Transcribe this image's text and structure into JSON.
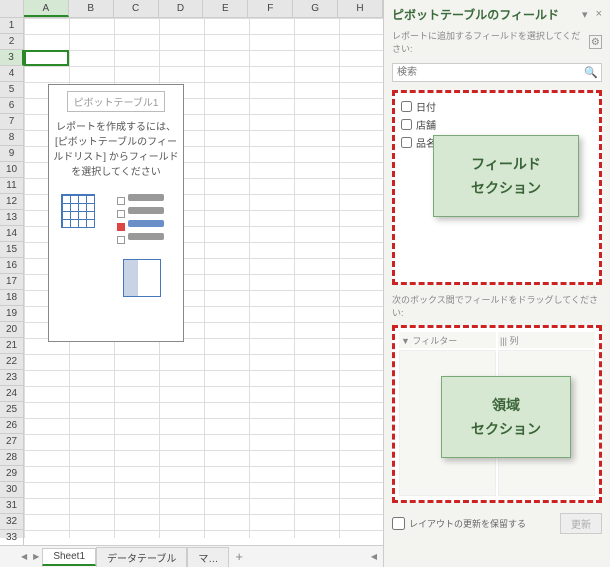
{
  "columns": [
    "A",
    "B",
    "C",
    "D",
    "E",
    "F",
    "G",
    "H"
  ],
  "row_count": 33,
  "active_cell": {
    "col": 0,
    "row": 3
  },
  "pivot_placeholder": {
    "title": "ピボットテーブル1",
    "text": "レポートを作成するには、[ピボットテーブルのフィールドリスト] からフィールドを選択してください"
  },
  "tabs": {
    "items": [
      "Sheet1",
      "データテーブル",
      "マ…"
    ],
    "active_index": 0,
    "add_label": "+"
  },
  "pivot_pane": {
    "title": "ピボットテーブルのフィールド",
    "subtitle": "レポートに追加するフィールドを選択してください:",
    "search_placeholder": "検索",
    "fields": [
      "日付",
      "店舗",
      "品名"
    ],
    "drag_label": "次のボックス間でフィールドをドラッグしてください:",
    "areas": {
      "filter": "▼ フィルター",
      "columns": "||| 列"
    },
    "footer": {
      "defer_label": "レイアウトの更新を保留する",
      "update_label": "更新"
    },
    "callout_field": {
      "line1": "フィールド",
      "line2": "セクション"
    },
    "callout_area": {
      "line1": "領域",
      "line2": "セクション"
    }
  }
}
